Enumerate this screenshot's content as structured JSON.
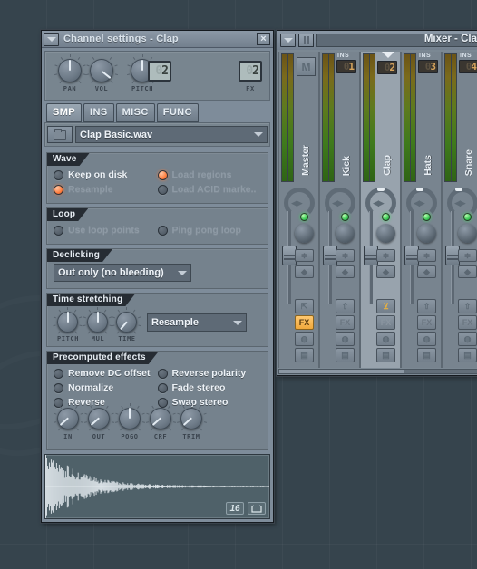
{
  "desktop": {
    "bg": "#36444d"
  },
  "channel_settings": {
    "title": "Channel settings - Clap",
    "menu_icon": "caret-down-icon",
    "close_label": "×",
    "knobs": [
      {
        "name": "PAN",
        "value_angle": 0
      },
      {
        "name": "VOL",
        "value_angle": 58
      },
      {
        "name": "PITCH",
        "value_angle": 0
      }
    ],
    "lcd_pitch": {
      "dim": "0",
      "value": "2"
    },
    "fx": {
      "label": "FX",
      "dim": "0",
      "value": "2"
    },
    "tabs": [
      {
        "label": "SMP",
        "active": true
      },
      {
        "label": "INS",
        "active": false
      },
      {
        "label": "MISC",
        "active": false
      },
      {
        "label": "FUNC",
        "active": false
      }
    ],
    "file": {
      "browse_icon": "folder-icon",
      "name": "Clap Basic.wav",
      "dropdown_icon": "chevron-down-icon"
    },
    "wave": {
      "caption": "Wave",
      "options": [
        {
          "label": "Keep on disk",
          "on": false,
          "disabled": false
        },
        {
          "label": "Resample",
          "on": true,
          "disabled": true
        },
        {
          "label": "Load regions",
          "on": true,
          "disabled": true
        },
        {
          "label": "Load ACID marke..",
          "on": false,
          "disabled": true
        }
      ]
    },
    "loop": {
      "caption": "Loop",
      "options": [
        {
          "label": "Use loop points",
          "on": false,
          "disabled": true
        },
        {
          "label": "Ping pong loop",
          "on": false,
          "disabled": true
        }
      ]
    },
    "declicking": {
      "caption": "Declicking",
      "value": "Out only (no bleeding)",
      "dropdown_icon": "chevron-down-icon"
    },
    "time_stretching": {
      "caption": "Time stretching",
      "knobs": [
        {
          "name": "PITCH",
          "value_angle": 0
        },
        {
          "name": "MUL",
          "value_angle": 0
        },
        {
          "name": "TIME",
          "value_angle": 35
        }
      ],
      "mode": "Resample",
      "dropdown_icon": "chevron-down-icon"
    },
    "precomputed_effects": {
      "caption": "Precomputed effects",
      "options": [
        {
          "label": "Remove DC offset",
          "on": false
        },
        {
          "label": "Normalize",
          "on": false
        },
        {
          "label": "Reverse",
          "on": false
        },
        {
          "label": "Reverse polarity",
          "on": false
        },
        {
          "label": "Fade stereo",
          "on": false
        },
        {
          "label": "Swap stereo",
          "on": false
        }
      ],
      "knobs": [
        {
          "name": "IN",
          "value_angle": -48
        },
        {
          "name": "OUT",
          "value_angle": -48
        },
        {
          "name": "POGO",
          "value_angle": 0
        },
        {
          "name": "CRF",
          "value_angle": -48
        },
        {
          "name": "TRIM",
          "value_angle": -48
        }
      ]
    },
    "waveform": {
      "zoom_label": "16",
      "tool_icon": "loop-region-icon"
    }
  },
  "mixer": {
    "title": "Mixer - Clap",
    "menu_icon": "caret-down-icon",
    "grip_icon": "grip-handle-icon",
    "search_value": "",
    "tracks": [
      {
        "name": "Master",
        "ins": null,
        "ins_dim": null,
        "selected": false,
        "mute_icon": "mute-icon",
        "fx_on": true,
        "route_on": false
      },
      {
        "name": "Kick",
        "ins": "1",
        "ins_dim": "0",
        "selected": false,
        "mute_icon": null,
        "fx_on": false,
        "route_on": false
      },
      {
        "name": "Clap",
        "ins": "2",
        "ins_dim": "0",
        "selected": true,
        "mute_icon": null,
        "fx_on": false,
        "route_on": true
      },
      {
        "name": "Hats",
        "ins": "3",
        "ins_dim": "0",
        "selected": false,
        "mute_icon": null,
        "fx_on": false,
        "route_on": false
      },
      {
        "name": "Snare",
        "ins": "4",
        "ins_dim": "0",
        "selected": false,
        "mute_icon": null,
        "fx_on": false,
        "route_on": false
      }
    ],
    "ins_caption": "INS",
    "buttons": {
      "fx_label": "FX",
      "route_icon": "route-icon",
      "link_icon": "link-icon",
      "clock_icon": "clock-icon",
      "save_icon": "save-icon",
      "pan_icon": "pan-icon",
      "stereo_icon": "stereo-sep-icon"
    }
  }
}
